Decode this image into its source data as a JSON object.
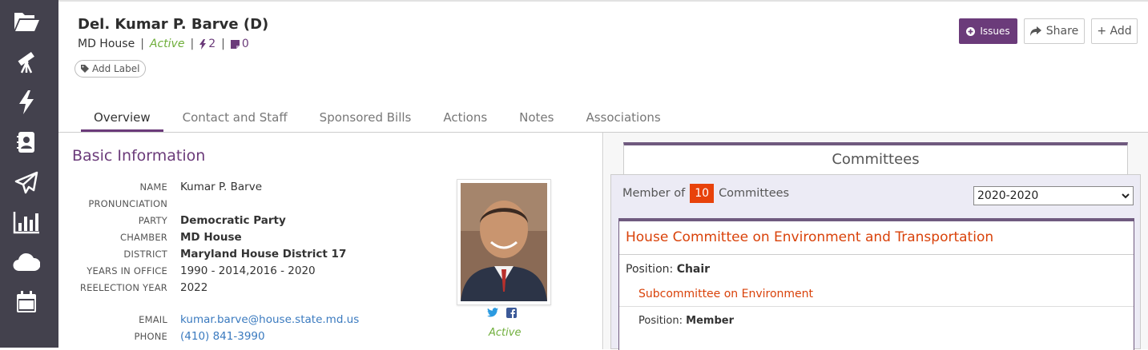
{
  "sidebar": {
    "items": [
      {
        "icon": "folder-open-icon"
      },
      {
        "icon": "telescope-icon"
      },
      {
        "icon": "lightning-icon"
      },
      {
        "icon": "contact-book-icon"
      },
      {
        "icon": "paper-plane-icon"
      },
      {
        "icon": "bar-chart-icon"
      },
      {
        "icon": "cloud-icon"
      },
      {
        "icon": "calendar-icon"
      }
    ]
  },
  "header": {
    "title": "Del. Kumar P. Barve (D)",
    "chamber": "MD House",
    "status": "Active",
    "actions_count": "2",
    "notes_count": "0",
    "add_label": "Add Label"
  },
  "toolbar": {
    "issues_label": "Issues",
    "share_label": "Share",
    "add_label": "+ Add"
  },
  "tabs": [
    {
      "label": "Overview",
      "active": true
    },
    {
      "label": "Contact and Staff"
    },
    {
      "label": "Sponsored Bills"
    },
    {
      "label": "Actions"
    },
    {
      "label": "Notes"
    },
    {
      "label": "Associations"
    }
  ],
  "basic_info": {
    "section_title": "Basic Information",
    "rows": [
      {
        "label": "Name",
        "value": "Kumar P. Barve"
      },
      {
        "label": "Pronunciation",
        "value": ""
      },
      {
        "label": "Party",
        "value": "Democratic Party"
      },
      {
        "label": "Chamber",
        "value": "MD House"
      },
      {
        "label": "District",
        "value": "Maryland House District 17"
      },
      {
        "label": "Years in Office",
        "value": "1990 - 2014,2016 - 2020"
      },
      {
        "label": "Reelection Year",
        "value": "2022"
      },
      {
        "label": "Email",
        "value": "kumar.barve@house.state.md.us"
      },
      {
        "label": "Phone",
        "value": "(410) 841-3990"
      }
    ],
    "photo_status": "Active"
  },
  "committees": {
    "header": "Committees",
    "member_of_prefix": "Member of",
    "count": "10",
    "member_of_suffix": "Committees",
    "year_selected": "2020-2020",
    "items": [
      {
        "name": "House Committee on Environment and Transportation",
        "position_label": "Position:",
        "position": "Chair",
        "subcommittee": {
          "name": "Subcommittee on Environment",
          "position_label": "Position:",
          "position": "Member"
        }
      }
    ]
  },
  "colors": {
    "sidebar_bg": "#43414d",
    "accent_purple": "#6b3b7a",
    "active_green": "#6fae3b",
    "committee_orange": "#d9420a",
    "link_blue": "#3a7abf"
  }
}
